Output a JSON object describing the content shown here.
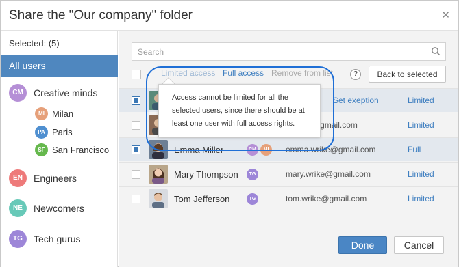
{
  "dialog": {
    "title": "Share the \"Our company\" folder",
    "close_glyph": "✕"
  },
  "sidebar": {
    "selected_label": "Selected: (5)",
    "all_users_label": "All users",
    "groups": [
      {
        "initials": "CM",
        "label": "Creative minds",
        "color": "#b58fd6"
      },
      {
        "initials": "EN",
        "label": "Engineers",
        "color": "#ee7a7a"
      },
      {
        "initials": "NE",
        "label": "Newcomers",
        "color": "#67c9b8"
      },
      {
        "initials": "TG",
        "label": "Tech gurus",
        "color": "#9d86d8"
      }
    ],
    "subgroups": [
      {
        "initials": "MI",
        "label": "Milan",
        "color": "#e6a07a"
      },
      {
        "initials": "PA",
        "label": "Paris",
        "color": "#4f8fd0"
      },
      {
        "initials": "SF",
        "label": "San Francisco",
        "color": "#66b84d"
      }
    ]
  },
  "search": {
    "placeholder": "Search",
    "value": ""
  },
  "toolbar": {
    "limited_label": "Limited access",
    "full_label": "Full access",
    "remove_label": "Remove from list",
    "help_glyph": "?",
    "back_label": "Back to selected"
  },
  "users": [
    {
      "name": "",
      "email": "",
      "access": "Limited",
      "exception": "Set exeption",
      "selected": true
    },
    {
      "name": "",
      "email": "r@gmail.com",
      "access": "Limited",
      "selected": false
    },
    {
      "name": "Emma Miller",
      "email": "emma.wrike@gmail.com",
      "access": "Full",
      "selected": true,
      "tags": [
        "CM",
        "MI"
      ]
    },
    {
      "name": "Mary Thompson",
      "email": "mary.wrike@gmail.com",
      "access": "Limited",
      "selected": false,
      "tags": [
        "TG"
      ]
    },
    {
      "name": "Tom Jefferson",
      "email": "tom.wrike@gmail.com",
      "access": "Limited",
      "selected": false,
      "tags": [
        "TG"
      ]
    }
  ],
  "tooltip": {
    "text": "Access cannot be limited for all the selected users, since there should be at least one user with full access rights."
  },
  "footer": {
    "done_label": "Done",
    "cancel_label": "Cancel"
  },
  "colors": {
    "accent": "#4f87bf",
    "link": "#3f7fc0",
    "highlight": "#1f6fd6"
  }
}
